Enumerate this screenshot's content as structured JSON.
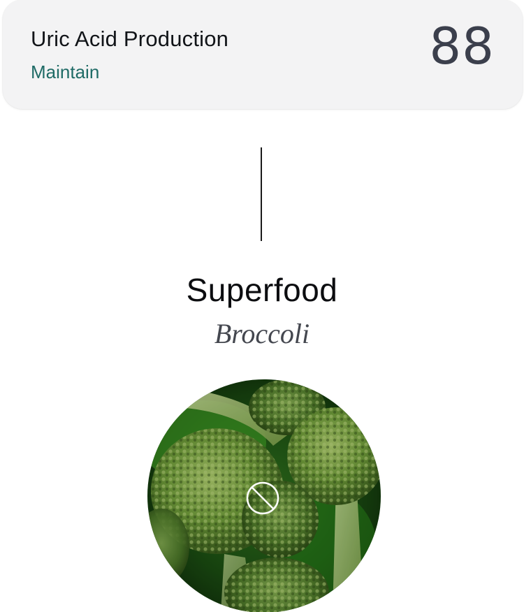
{
  "metric": {
    "title": "Uric Acid Production",
    "status": "Maintain",
    "score": "88"
  },
  "recommendation": {
    "category": "Superfood",
    "food_name": "Broccoli",
    "image_icon": "broccoli-photo",
    "overlay_icon": "prohibited-icon"
  },
  "colors": {
    "status_text": "#1f6b66",
    "score_text": "#3b3f4c",
    "card_background": "#f3f3f4"
  }
}
